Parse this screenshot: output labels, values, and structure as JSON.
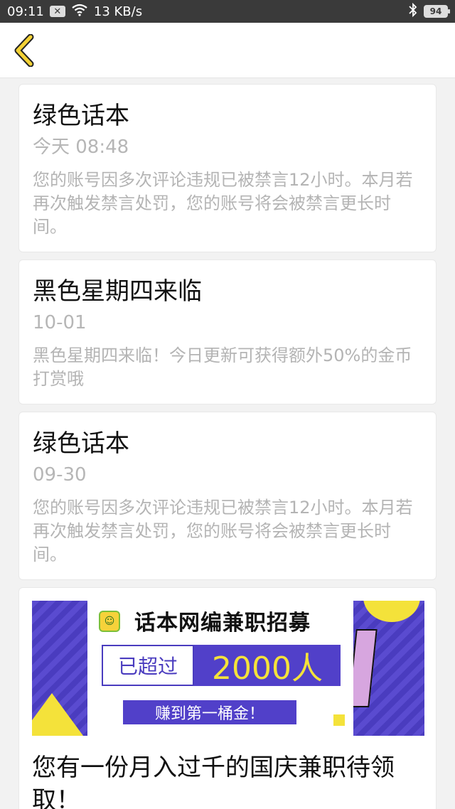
{
  "status_bar": {
    "time": "09:11",
    "notification_icon": "close-box-icon",
    "wifi_icon": "wifi-icon",
    "network_speed": "13 KB/s",
    "bluetooth_icon": "bluetooth-icon",
    "battery": "94"
  },
  "header": {
    "back_icon": "chevron-left-icon",
    "accent_color": "#f4d235"
  },
  "messages": [
    {
      "title": "绿色话本",
      "date": "今天 08:48",
      "body": "您的账号因多次评论违规已被禁言12小时。本月若再次触发禁言处罚，您的账号将会被禁言更长时间。"
    },
    {
      "title": "黑色星期四来临",
      "date": "10-01",
      "body": "黑色星期四来临！今日更新可获得额外50%的金币打赏哦"
    },
    {
      "title": "绿色话本",
      "date": "09-30",
      "body": "您的账号因多次评论违规已被禁言12小时。本月若再次触发禁言处罚，您的账号将会被禁言更长时间。"
    }
  ],
  "promo": {
    "banner_title": "话本网编兼职招募",
    "exceed_label": "已超过",
    "count_label": "2000人",
    "earn_label": "赚到第一桶金！",
    "caption": "您有一份月入过千的国庆兼职待领取！"
  }
}
